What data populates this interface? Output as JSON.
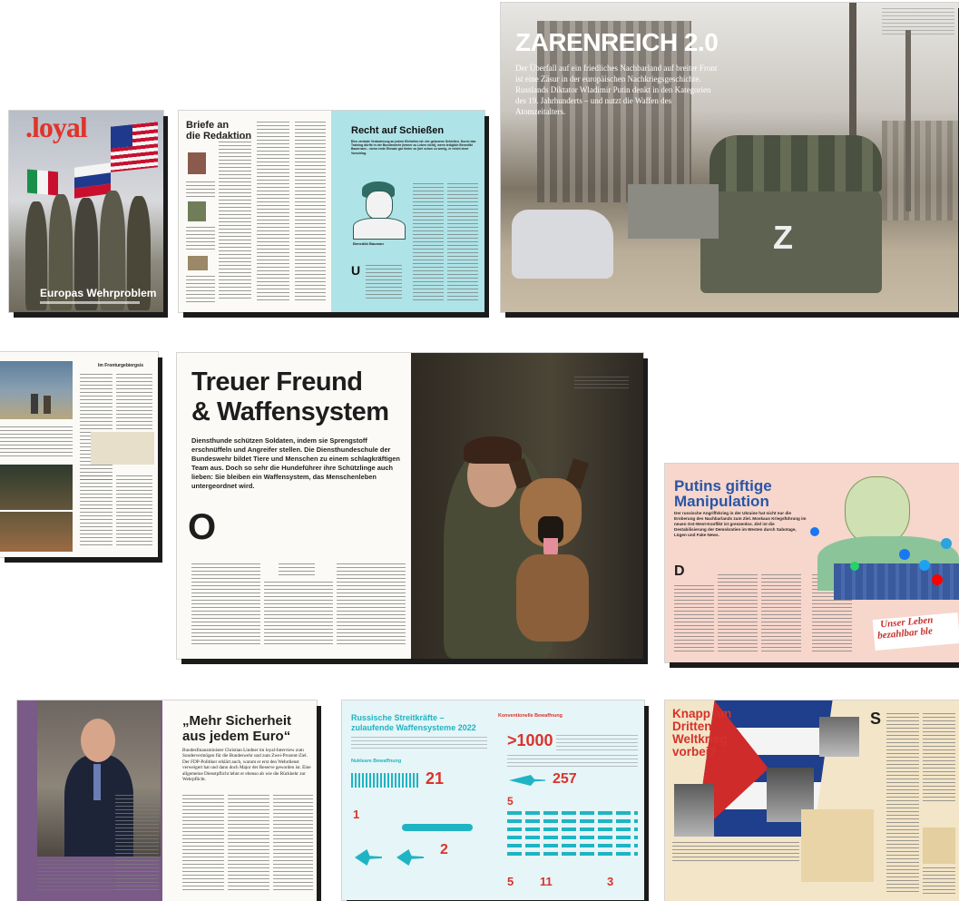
{
  "cover": {
    "logo": ".loyal",
    "headline": "Europas Wehrproblem",
    "colors": {
      "logo": "#e0342a",
      "sky": "#c9ccd2",
      "flag_red": "#c8102e",
      "flag_blue": "#1f3a8c"
    }
  },
  "letters": {
    "heading_line1": "Briefe an",
    "heading_line2": "die Redaktion"
  },
  "shooting": {
    "title": "Recht auf Schießen",
    "lead": "Eine zentrale Veränderung an jedem Einheiten ist: der geborene Schießen. Durch das Training dürfte in der Bundeswehr (immer zu Leben nicht), wenn lediglich Benedikt Bauernam – wenn erste Einsatz gar hinter zu (bei schon zu wenig, er reicht einer Vorschlag.",
    "portrait_caption": "Benedikt Bauman",
    "colors": {
      "accent": "#aee3e7"
    }
  },
  "zarenreich": {
    "title": "ZARENREICH 2.0",
    "lead": "Der Überfall auf ein friedliches Nachbarland auf breiter Front ist eine Zäsur in der europäischen Nachkriegsgeschichte. Russlands Diktator Wladimir Putin denkt in den Kategorien des 19. Jahrhunderts – und nutzt die Waffen des Atomzeitalters.",
    "vehicle_mark": "Z"
  },
  "frontline": {
    "heading": "Im Fronturgebiergsis"
  },
  "dog": {
    "title_line1": "Treuer Freund",
    "title_line2": "& Waffensystem",
    "lead": "Diensthunde schützen Soldaten, indem sie Sprengstoff erschnüffeln und Angreifer stellen. Die Diensthundeschule der Bundeswehr bildet Tiere und Menschen zu einem schlagkräftigen Team aus. Doch so sehr die Hundeführer ihre Schützlinge auch lieben: Sie bleiben ein Waffensystem, das Menschenleben untergeordnet wird.",
    "dropcap": "O"
  },
  "putin": {
    "title_line1": "Putins giftige",
    "title_line2": "Manipulation",
    "lead": "Der russische Angriffskrieg in der Ukraine hat nicht nur die Eroberung des Nachbarlands zum Ziel. Moskaus Kriegsführung im neuen Ost-West-Konflikt ist grenzenlos. Ziel ist die Destabilisierung der Demokratien im Westen durch Sabotage, Lügen und Fake News.",
    "dropcap": "D",
    "banner_line1": "Unser Leben",
    "banner_line2": "bezahlbar ble",
    "colors": {
      "bg": "#f7d6cc",
      "title": "#2856a6",
      "banner": "#c7322e"
    }
  },
  "lindner": {
    "title_line1": "„Mehr Sicherheit",
    "title_line2": "aus jedem Euro“",
    "lead": "Bundesfinanzminister Christian Lindner im loyal-Interview zum Sondervermögen für die Bundeswehr und zum Zwei-Prozent-Ziel. Der FDP-Politiker erklärt auch, warum er erst den Wehrdienst verweigert hat und dann doch Major der Reserve geworden ist. Eine allgemeine Dienstpflicht lehnt er ebenso ab wie die Rückkehr zur Wehrpflicht.",
    "colors": {
      "panel": "#7a5a87"
    }
  },
  "forces": {
    "title_line1": "Russische Streitkräfte –",
    "title_line2": "zulaufende Waffensysteme 2022",
    "conventional": "Konventionelle Bewaffnung",
    "nuclear": "Nukleare Bewaffnung",
    "stat_1000": ">1000",
    "stat_257": "257",
    "stat_21": "21",
    "stat_5a": "5",
    "stat_1": "1",
    "stat_2": "2",
    "stat_5b": "5",
    "stat_11": "11",
    "stat_3": "3",
    "colors": {
      "teal": "#1fb4c3",
      "red": "#d9332c",
      "bg": "#e6f5f7"
    }
  },
  "cuba": {
    "title_line1": "Knapp am",
    "title_line2": "Dritten",
    "title_line3": "Weltkrieg",
    "title_line4": "vorbei?",
    "dropcap": "S",
    "colors": {
      "bg": "#f3e5c7",
      "title": "#d5322b"
    }
  }
}
